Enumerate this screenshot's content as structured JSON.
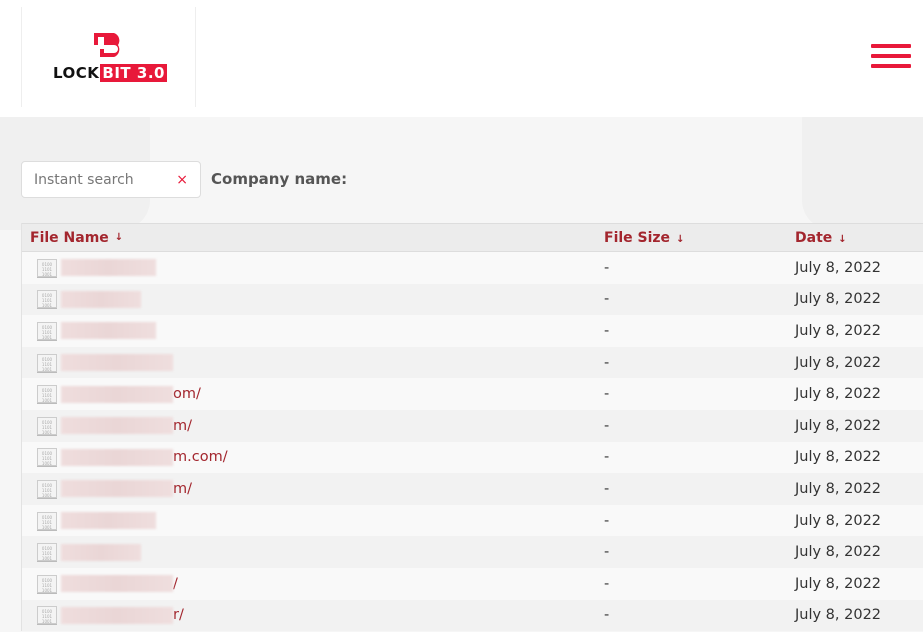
{
  "brand": {
    "logo_text": "LOCK",
    "logo_highlight": "BIT 3.0",
    "accent": "#e8193a"
  },
  "search": {
    "placeholder": "Instant search",
    "clear": "×"
  },
  "company_label": "Company name:",
  "table": {
    "headers": [
      "File Name",
      "File Size",
      "Date"
    ],
    "sort_icon": "↓",
    "rows": [
      {
        "name": "",
        "size": "-",
        "date": "July 8, 2022"
      },
      {
        "name": "",
        "size": "-",
        "date": "July 8, 2022"
      },
      {
        "name": "",
        "size": "-",
        "date": "July 8, 2022"
      },
      {
        "name": "",
        "size": "-",
        "date": "July 8, 2022"
      },
      {
        "name": "om/",
        "size": "-",
        "date": "July 8, 2022"
      },
      {
        "name": "m/",
        "size": "-",
        "date": "July 8, 2022"
      },
      {
        "name": "m.com/",
        "size": "-",
        "date": "July 8, 2022"
      },
      {
        "name": "m/",
        "size": "-",
        "date": "July 8, 2022"
      },
      {
        "name": "",
        "size": "-",
        "date": "July 8, 2022"
      },
      {
        "name": "",
        "size": "-",
        "date": "July 8, 2022"
      },
      {
        "name": "/",
        "size": "-",
        "date": "July 8, 2022"
      },
      {
        "name": "r/",
        "size": "-",
        "date": "July 8, 2022"
      }
    ]
  }
}
